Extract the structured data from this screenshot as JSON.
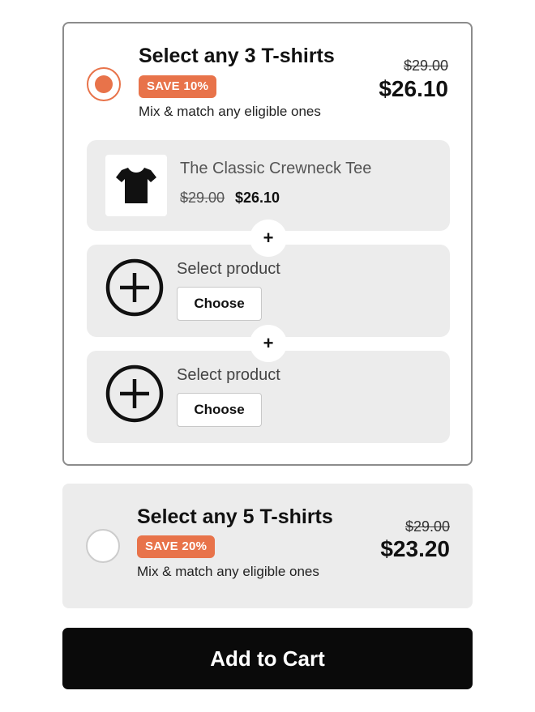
{
  "bundles": [
    {
      "title": "Select any 3 T-shirts",
      "badge": "SAVE 10%",
      "description": "Mix & match any eligible ones",
      "compare_price": "$29.00",
      "price": "$26.10",
      "selected": true,
      "items": [
        {
          "name": "The Classic Crewneck Tee",
          "compare_price": "$29.00",
          "price": "$26.10",
          "icon": "tshirt-icon"
        },
        {
          "label": "Select product",
          "button": "Choose",
          "icon": "add-circle-icon"
        },
        {
          "label": "Select product",
          "button": "Choose",
          "icon": "add-circle-icon"
        }
      ],
      "connector": "+"
    },
    {
      "title": "Select any 5 T-shirts",
      "badge": "SAVE 20%",
      "description": "Mix & match any eligible ones",
      "compare_price": "$29.00",
      "price": "$23.20",
      "selected": false
    }
  ],
  "add_to_cart": "Add to Cart",
  "colors": {
    "accent": "#e8734a",
    "selected_border": "#8c8c8c",
    "panel_bg": "#ececec",
    "button_bg": "#0a0a0a"
  }
}
